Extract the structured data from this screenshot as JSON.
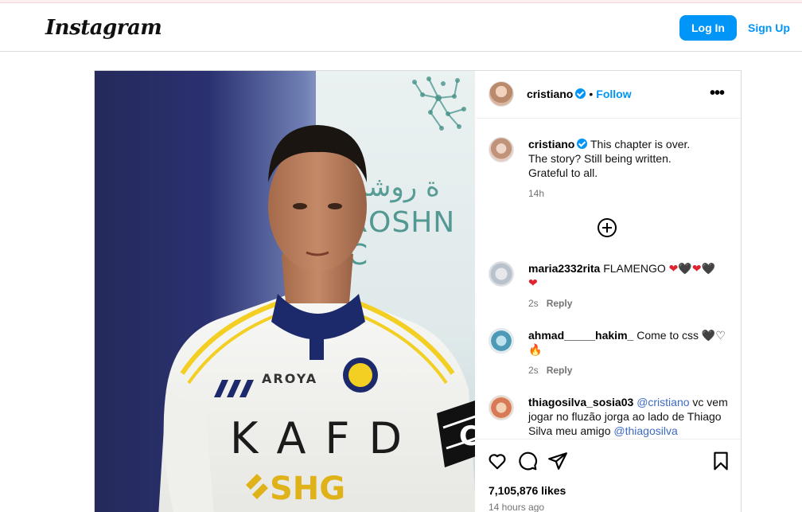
{
  "nav": {
    "logo": "Instagram",
    "login_label": "Log In",
    "signup_label": "Sign Up"
  },
  "post": {
    "author": "cristiano",
    "follow_label": "Follow",
    "separator": "•",
    "more_icon": "more-horizontal-icon",
    "caption": {
      "username": "cristiano",
      "line1": "This chapter is over.",
      "line2": "The story? Still being written.",
      "line3": "Grateful to all.",
      "time": "14h"
    },
    "photo": {
      "billboard_arabic": "ة روشن",
      "billboard_english": "ROSHN C",
      "sponsor_main": "KAFD",
      "sponsor_chest": "AROYA",
      "sponsor_bottom": "SHG",
      "captain_band": "C"
    },
    "comments": [
      {
        "username": "maria2332rita",
        "text": "FLAMENGO",
        "time": "2s",
        "reply_label": "Reply"
      },
      {
        "username": "ahmad_____hakim_",
        "text": "Come to css",
        "time": "2s",
        "reply_label": "Reply"
      },
      {
        "username": "thiagosilva_sosia03",
        "mention1": "@cristiano",
        "text_mid": "vc vem jogar no fluzão jorga ao lado de Thiago Silva meu amigo",
        "mention2": "@thiagosilva"
      }
    ],
    "likes": "7,105,876 likes",
    "posted": "14 hours ago"
  },
  "colors": {
    "primary_blue": "#0095f6",
    "border": "#dbdbdb",
    "muted_text": "#737373",
    "mention": "#3d6ac4"
  }
}
